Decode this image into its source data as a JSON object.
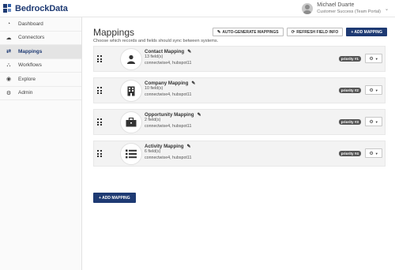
{
  "header": {
    "brand": "BedrockData",
    "user_name": "Michael Duarte",
    "user_role": "Customer Success (Team Portal)",
    "caret": "⌄"
  },
  "sidebar": {
    "items": [
      {
        "label": "Dashboard",
        "icon": "dashboard-icon",
        "glyph": "◔",
        "active": false
      },
      {
        "label": "Connectors",
        "icon": "cloud-icon",
        "glyph": "☁",
        "active": false
      },
      {
        "label": "Mappings",
        "icon": "exchange-icon",
        "glyph": "⇄",
        "active": true
      },
      {
        "label": "Workflows",
        "icon": "sitemap-icon",
        "glyph": "⛬",
        "active": false
      },
      {
        "label": "Explore",
        "icon": "eye-icon",
        "glyph": "◉",
        "active": false
      },
      {
        "label": "Admin",
        "icon": "gear-icon",
        "glyph": "⚙",
        "active": false
      }
    ]
  },
  "main": {
    "title": "Mappings",
    "subtitle": "Choose which records and fields should sync between systems.",
    "actions": {
      "auto_generate": "AUTO-GENERATE MAPPINGS",
      "refresh": "REFRESH FIELD INFO",
      "add": "+ ADD MAPPING"
    },
    "mappings": [
      {
        "name": "Contact Mapping",
        "fields": "13 field(s)",
        "systems": "connectwise4, hubspot11",
        "priority": "priority #1",
        "icon": "user-icon"
      },
      {
        "name": "Company Mapping",
        "fields": "10 field(s)",
        "systems": "connectwise4, hubspot11",
        "priority": "priority #2",
        "icon": "building-icon"
      },
      {
        "name": "Opportunity Mapping",
        "fields": "2 field(s)",
        "systems": "connectwise4, hubspot11",
        "priority": "priority #3",
        "icon": "briefcase-icon"
      },
      {
        "name": "Activity Mapping",
        "fields": "6 field(s)",
        "systems": "connectwise4, hubspot11",
        "priority": "priority #4",
        "icon": "list-icon"
      }
    ],
    "add_bottom": "+ ADD MAPPING"
  },
  "colors": {
    "brand": "#1e3a73",
    "badge": "#555555",
    "row_bg": "#f3f3f3"
  }
}
